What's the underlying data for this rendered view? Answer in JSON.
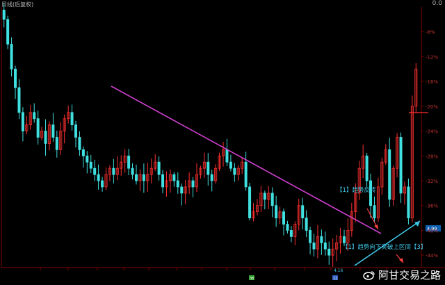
{
  "header": {
    "title": "日线(后复权)",
    "corner_value": "0.0"
  },
  "watermark": {
    "text": "阿甘交易之路",
    "icon": "weibo-icon"
  },
  "colors": {
    "up": "#ff3030",
    "down": "#40e0e0",
    "ma": "#e8e8e8",
    "trend_down": "#d040d0",
    "trend_up": "#40c8e8",
    "axis": "#800000",
    "annot": "#40c8e8",
    "arrow": "#ff4040"
  },
  "chart_data": {
    "type": "candlestick",
    "y_axis_side": "right",
    "y_ticks": [
      "-8%",
      "-12%",
      "-16%",
      "-20%",
      "-24%",
      "-28%",
      "-32%",
      "-36%",
      "-40%",
      "-44%"
    ],
    "price_labels": [
      "4.99",
      "4.16"
    ],
    "annotations": [
      "【1】趋势反转",
      "【1】趋势向下突破上区间【3】"
    ],
    "bottom_badges": [
      "38",
      "12"
    ],
    "series_note": "price path digitised approx. in y-axis percent units",
    "closes": [
      -6,
      -10,
      -14,
      -17,
      -21,
      -24,
      -23,
      -21,
      -22,
      -25,
      -24,
      -26,
      -23,
      -25,
      -27,
      -24,
      -22,
      -21,
      -23,
      -25,
      -27,
      -28,
      -29,
      -30,
      -31,
      -32,
      -33,
      -31,
      -30,
      -31,
      -30,
      -29,
      -28,
      -30,
      -31,
      -32,
      -31,
      -32,
      -31,
      -30,
      -29,
      -31,
      -33,
      -32,
      -31,
      -32,
      -33,
      -34,
      -33,
      -32,
      -33,
      -31,
      -30,
      -29,
      -31,
      -32,
      -30,
      -28,
      -27,
      -29,
      -30,
      -31,
      -30,
      -29,
      -33,
      -38,
      -37,
      -36,
      -34,
      -35,
      -34,
      -36,
      -38,
      -37,
      -39,
      -40,
      -41,
      -39,
      -36,
      -38,
      -40,
      -42,
      -43,
      -41,
      -42,
      -43,
      -44,
      -43,
      -42,
      -41,
      -42,
      -40,
      -37,
      -34,
      -30,
      -28,
      -32,
      -36,
      -38,
      -33,
      -29,
      -27,
      -35,
      -30,
      -25,
      -34,
      -33,
      -38,
      -20,
      -14
    ]
  }
}
